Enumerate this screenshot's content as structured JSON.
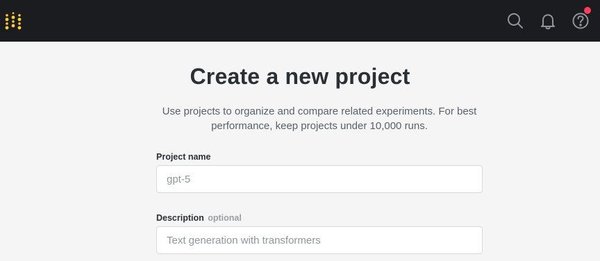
{
  "topbar": {
    "logo_icon": "wandb-dots-logo-icon",
    "search_icon": "search-icon",
    "notifications_icon": "bell-icon",
    "help_icon": "question-circle-icon",
    "help_badge_color": "#ff3d5f",
    "logo_color": "#ffc933",
    "background_color": "#1a1c1f"
  },
  "page": {
    "title": "Create a new project",
    "subtitle": "Use projects to organize and compare related experiments. For best performance, keep projects under 10,000 runs."
  },
  "form": {
    "project_name": {
      "label": "Project name",
      "placeholder": "gpt-5",
      "value": ""
    },
    "description": {
      "label": "Description",
      "optional_label": "optional",
      "placeholder": "Text generation with transformers",
      "value": ""
    }
  }
}
